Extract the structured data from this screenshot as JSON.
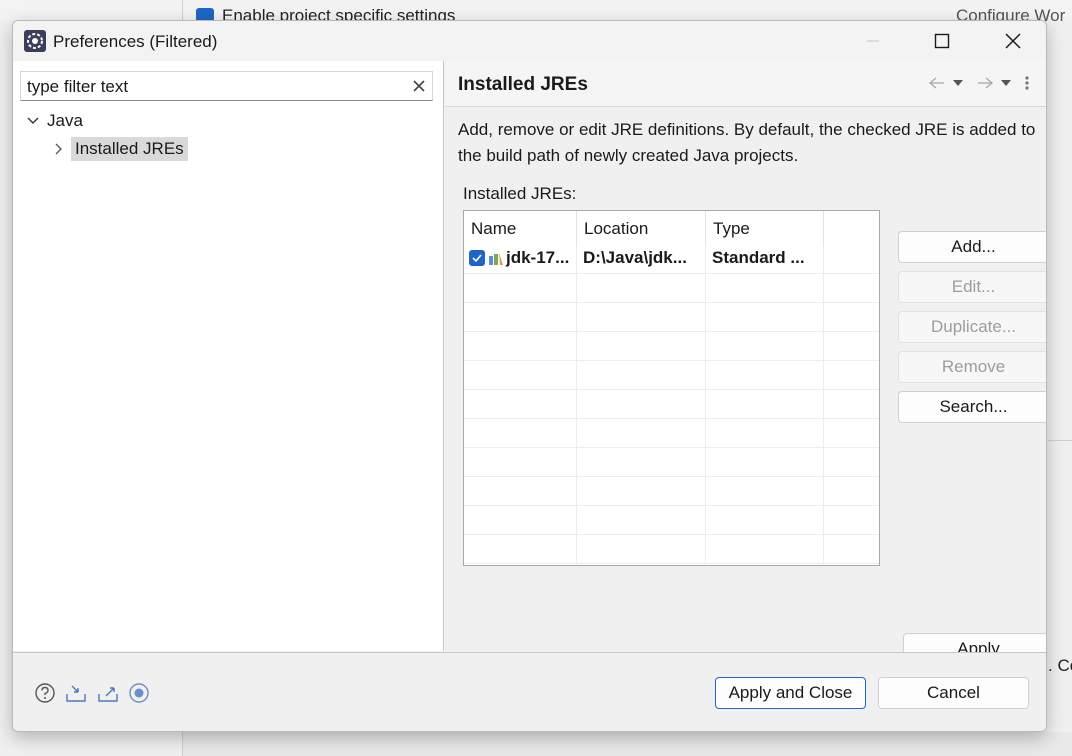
{
  "background": {
    "checkbox_label": "Enable project specific settings",
    "link": "Configure Wor",
    "right_fragment": ". Co"
  },
  "dialog": {
    "title": "Preferences (Filtered)"
  },
  "filter": {
    "placeholder": "type filter text"
  },
  "tree": {
    "root": "Java",
    "child": "Installed JREs"
  },
  "page": {
    "title": "Installed JREs",
    "description": "Add, remove or edit JRE definitions. By default, the checked JRE is added to the build path of newly created Java projects.",
    "table_label": "Installed JREs:",
    "columns": [
      "Name",
      "Location",
      "Type"
    ],
    "rows": [
      {
        "checked": true,
        "name": "jdk-17...",
        "location": "D:\\Java\\jdk...",
        "type": "Standard ..."
      }
    ],
    "buttons": {
      "add": "Add...",
      "edit": "Edit...",
      "duplicate": "Duplicate...",
      "remove": "Remove",
      "search": "Search..."
    },
    "apply": "Apply"
  },
  "footer": {
    "apply_close": "Apply and Close",
    "cancel": "Cancel",
    "icons": [
      "help-icon",
      "import-icon",
      "export-icon",
      "record-icon"
    ]
  },
  "colors": {
    "accent": "#1e66c6",
    "selection": "#d9d9d9"
  }
}
